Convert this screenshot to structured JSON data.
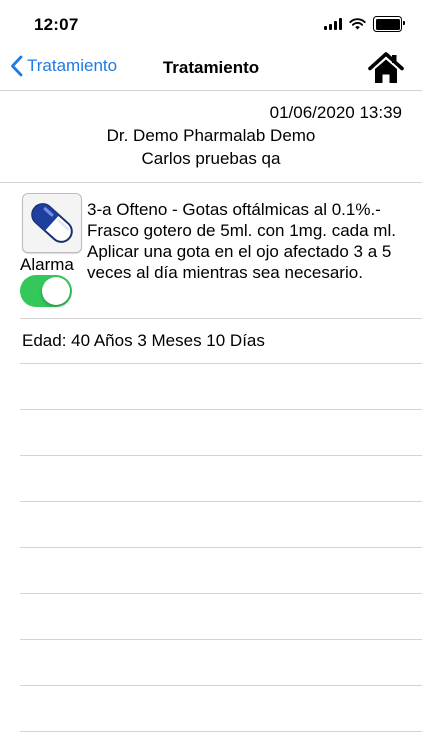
{
  "status_bar": {
    "time": "12:07"
  },
  "nav": {
    "back_label": "Tratamiento",
    "title": "Tratamiento",
    "home_icon": "home-icon"
  },
  "header": {
    "datetime": "01/06/2020 13:39",
    "doctor": "Dr. Demo Pharmalab Demo",
    "patient": "Carlos pruebas qa"
  },
  "medication": {
    "icon": "pill-capsule-icon",
    "alarm_label": "Alarma",
    "alarm_on": true,
    "name": "3-a Ofteno - Gotas oftálmicas al 0.1%.- Frasco gotero de 5ml. con 1mg. cada ml.",
    "instructions": "Aplicar una gota en el ojo afectado 3 a 5 veces al día mientras sea necesario."
  },
  "age": {
    "text": "Edad: 40 Años 3 Meses 10 Días"
  },
  "colors": {
    "accent": "#1e7be3",
    "toggle_on": "#34c759",
    "separator": "#d4d4d4"
  }
}
